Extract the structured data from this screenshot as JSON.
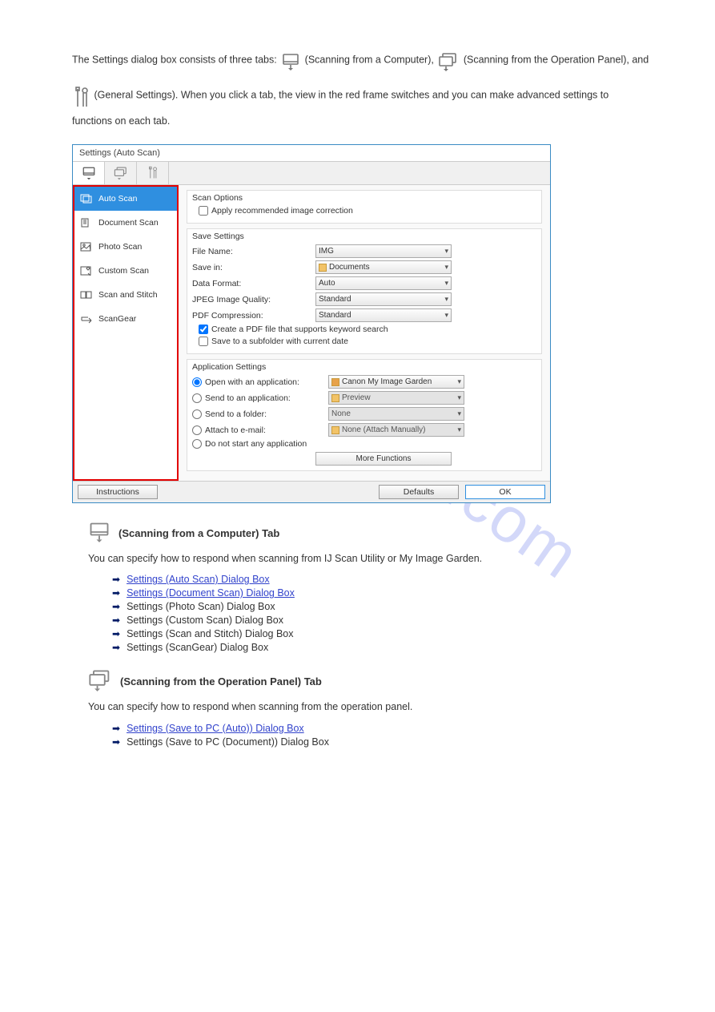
{
  "watermark_text": "manualshive.com",
  "intro": {
    "p1_prefix": "The Settings dialog box consists of three tabs: ",
    "tab1": " (Scanning from a Computer)",
    "sep": ", ",
    "tab2": " (Scanning from the Operation Panel)",
    "and": ", and ",
    "tab3": " (General Settings)",
    "p1_suffix": ". When you click a tab, the view in the red frame switches and you can make advanced settings to functions on each tab."
  },
  "dialog": {
    "title": "Settings (Auto Scan)",
    "sidebar": {
      "items": [
        {
          "label": "Auto Scan"
        },
        {
          "label": "Document Scan"
        },
        {
          "label": "Photo Scan"
        },
        {
          "label": "Custom Scan"
        },
        {
          "label": "Scan and Stitch"
        },
        {
          "label": "ScanGear"
        }
      ]
    },
    "scan_options": {
      "title": "Scan Options",
      "apply_corr": "Apply recommended image correction"
    },
    "save_settings": {
      "title": "Save Settings",
      "file_name_label": "File Name:",
      "file_name_value": "IMG",
      "save_in_label": "Save in:",
      "save_in_value": "Documents",
      "data_format_label": "Data Format:",
      "data_format_value": "Auto",
      "jpeg_label": "JPEG Image Quality:",
      "jpeg_value": "Standard",
      "pdf_comp_label": "PDF Compression:",
      "pdf_comp_value": "Standard",
      "create_pdf": "Create a PDF file that supports keyword search",
      "save_subfolder": "Save to a subfolder with current date"
    },
    "app_settings": {
      "title": "Application Settings",
      "open_with": "Open with an application:",
      "open_with_value": "Canon My Image Garden",
      "send_app": "Send to an application:",
      "send_app_value": "Preview",
      "send_folder": "Send to a folder:",
      "send_folder_value": "None",
      "attach_email": "Attach to e-mail:",
      "attach_email_value": "None (Attach Manually)",
      "no_app": "Do not start any application",
      "more_functions": "More Functions"
    },
    "footer": {
      "instructions": "Instructions",
      "defaults": "Defaults",
      "ok": "OK"
    }
  },
  "section_scan_pc": {
    "heading": " (Scanning from a Computer) Tab",
    "desc": "You can specify how to respond when scanning from IJ Scan Utility or My Image Garden.",
    "links": [
      {
        "label": "Settings (Auto Scan) Dialog Box",
        "link": true
      },
      {
        "label": "Settings (Document Scan) Dialog Box",
        "link": true
      },
      {
        "label": "Settings (Photo Scan) Dialog Box",
        "link": false
      },
      {
        "label": "Settings (Custom Scan) Dialog Box",
        "link": false
      },
      {
        "label": "Settings (Scan and Stitch) Dialog Box",
        "link": false
      },
      {
        "label": "Settings (ScanGear) Dialog Box",
        "link": false
      }
    ]
  },
  "section_scan_panel": {
    "heading": " (Scanning from the Operation Panel) Tab",
    "desc": "You can specify how to respond when scanning from the operation panel.",
    "links": [
      {
        "label": "Settings (Save to PC (Auto)) Dialog Box",
        "link": true
      },
      {
        "label": "Settings (Save to PC (Document)) Dialog Box",
        "link": false
      }
    ]
  }
}
